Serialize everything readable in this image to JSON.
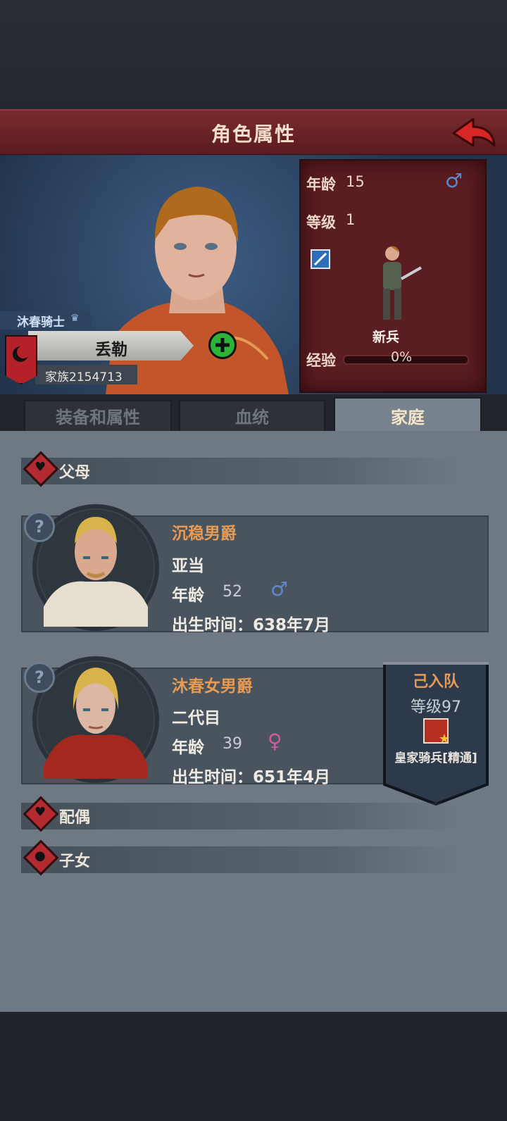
{
  "header": {
    "title": "角色属性",
    "back": "back-arrow-icon"
  },
  "character": {
    "title": "沐春骑士",
    "name": "丢勒",
    "family": "家族2154713",
    "age_label": "年龄",
    "age": "15",
    "level_label": "等级",
    "level": "1",
    "unit": "新兵",
    "exp_label": "经验",
    "exp": "0%",
    "exp_fraction": 0,
    "gender": "male"
  },
  "tabs": [
    {
      "label": "装备和属性"
    },
    {
      "label": "血统"
    },
    {
      "label": "家庭"
    }
  ],
  "active_tab": 2,
  "sections": {
    "parents": "父母",
    "spouse": "配偶",
    "children": "子女"
  },
  "parents": [
    {
      "title": "沉稳男爵",
      "name": "亚当",
      "age_label": "年龄",
      "age": "52",
      "gender": "male",
      "birth": "出生时间：638年7月"
    },
    {
      "title": "沐春女男爵",
      "name": "二代目",
      "age_label": "年龄",
      "age": "39",
      "gender": "female",
      "birth": "出生时间：651年4月"
    }
  ],
  "badge": {
    "status": "己入队",
    "level": "等级97",
    "unit": "皇家骑兵[精通]"
  },
  "colors": {
    "accent": "#e79a53",
    "titlebar": "#6a2226",
    "panel": "#5a1d22",
    "male": "#5f88c9",
    "female": "#d45aa0"
  }
}
